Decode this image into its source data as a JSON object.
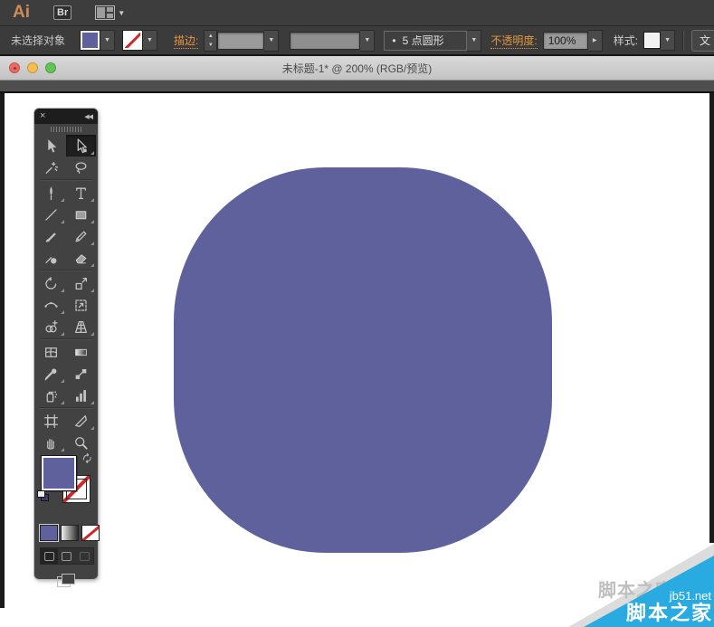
{
  "menubar": {
    "app_logo": "Ai",
    "bridge_label": "Br"
  },
  "controlbar": {
    "status": "未选择对象",
    "stroke_label": "描边:",
    "brush_bullet": "•",
    "brush_value": "5 点圆形",
    "opacity_label": "不透明度:",
    "opacity_value": "100%",
    "style_label": "样式:",
    "doc_setup_partial": "文"
  },
  "titlebar": {
    "title": "未标题-1* @ 200% (RGB/预览)"
  },
  "glyphs": {
    "close": "×",
    "collapse": "◀◀",
    "dropdown": "▼",
    "up": "▲",
    "down": "▼",
    "right": "▶"
  },
  "toolbar": {
    "divider_before": [
      4,
      12,
      18,
      24
    ],
    "tools": [
      {
        "name": "selection",
        "flyout": false,
        "selected": false
      },
      {
        "name": "direct-selection",
        "flyout": true,
        "selected": true
      },
      {
        "name": "magic-wand",
        "flyout": false,
        "selected": false
      },
      {
        "name": "lasso",
        "flyout": false,
        "selected": false
      },
      {
        "name": "pen",
        "flyout": true,
        "selected": false
      },
      {
        "name": "type",
        "flyout": true,
        "selected": false
      },
      {
        "name": "line-segment",
        "flyout": true,
        "selected": false
      },
      {
        "name": "rectangle",
        "flyout": true,
        "selected": false
      },
      {
        "name": "paintbrush",
        "flyout": false,
        "selected": false
      },
      {
        "name": "pencil",
        "flyout": true,
        "selected": false
      },
      {
        "name": "blob-brush",
        "flyout": false,
        "selected": false
      },
      {
        "name": "eraser",
        "flyout": true,
        "selected": false
      },
      {
        "name": "rotate",
        "flyout": true,
        "selected": false
      },
      {
        "name": "scale",
        "flyout": true,
        "selected": false
      },
      {
        "name": "width",
        "flyout": true,
        "selected": false
      },
      {
        "name": "free-transform",
        "flyout": false,
        "selected": false
      },
      {
        "name": "shape-builder",
        "flyout": true,
        "selected": false
      },
      {
        "name": "perspective-grid",
        "flyout": true,
        "selected": false
      },
      {
        "name": "mesh",
        "flyout": false,
        "selected": false
      },
      {
        "name": "gradient",
        "flyout": false,
        "selected": false
      },
      {
        "name": "eyedropper",
        "flyout": true,
        "selected": false
      },
      {
        "name": "blend",
        "flyout": false,
        "selected": false
      },
      {
        "name": "symbol-sprayer",
        "flyout": true,
        "selected": false
      },
      {
        "name": "column-graph",
        "flyout": true,
        "selected": false
      },
      {
        "name": "artboard",
        "flyout": false,
        "selected": false
      },
      {
        "name": "slice",
        "flyout": true,
        "selected": false
      },
      {
        "name": "hand",
        "flyout": true,
        "selected": false
      },
      {
        "name": "zoom",
        "flyout": false,
        "selected": false
      }
    ]
  },
  "canvas": {
    "shape_fill": "#5e619c"
  },
  "colors": {
    "fill_swatch": "#5e619c",
    "label_orange": "#e6963f",
    "watermark_blue": "#29abe2"
  },
  "watermark": {
    "site": "jb51.net",
    "name": "脚本之家"
  }
}
